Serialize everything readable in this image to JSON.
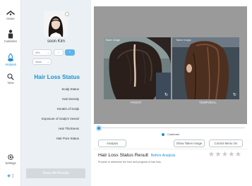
{
  "nav": {
    "home_label": "Home",
    "customer_label": "Customer",
    "analysis_label": "Analysis",
    "view_label": "View",
    "settings_label": "Settings",
    "active": "Analysis",
    "accent_color": "#1a8fd6"
  },
  "profile": {
    "name": "soon Kim",
    "age_value": "40's",
    "region_value": "Asian",
    "gender_options": [
      "male",
      "female"
    ],
    "gender_selected": "female"
  },
  "status_panel": {
    "title": "Hair Loss Status",
    "items": [
      "Scalp Status",
      "Hair Density",
      "Keratin of Scalp",
      "Exposure of Scalp's Vessel",
      "Hair Thickness",
      "Hair Pore Status"
    ],
    "show_all_label": "Show All Results"
  },
  "viewer": {
    "left_tag": "Base Image",
    "right_tag": "Taken Image",
    "left_caption": "FRONT",
    "right_caption": "TEMPORAL",
    "background_color": "#9a9a9a"
  },
  "legend": {
    "series_label": "Customer"
  },
  "actions": {
    "analysis_label": "Analysis",
    "show_taken_label": "Show Taken Image",
    "control_menu_label": "Control Menu On"
  },
  "result": {
    "title": "Hair Loss Status Result",
    "before_link": "Before Analysis",
    "description": "Process to determine the form and progress of hair loss.",
    "stars_filled": 0,
    "stars_total": 5
  }
}
